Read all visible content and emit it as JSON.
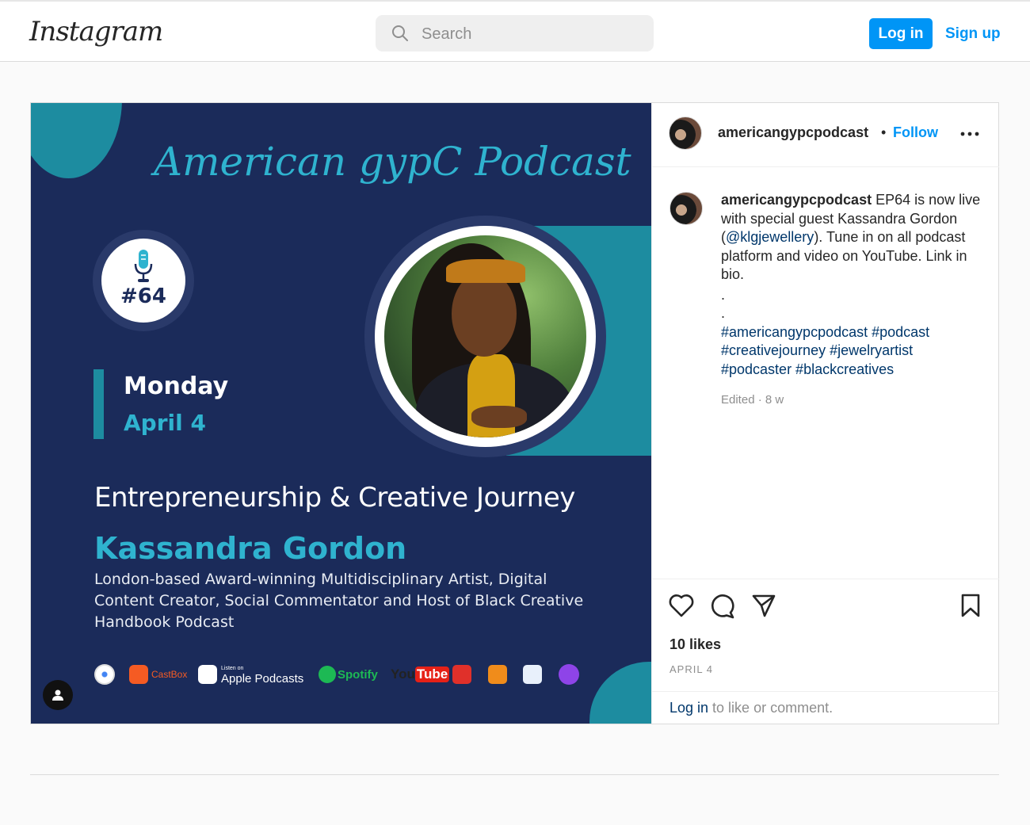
{
  "header": {
    "logo_text": "Instagram",
    "search_placeholder": "Search",
    "login_label": "Log in",
    "signup_label": "Sign up"
  },
  "post_image": {
    "podcast_title": "American gypC Podcast",
    "episode": "#64",
    "day": "Monday",
    "date": "April 4",
    "topic": "Entrepreneurship & Creative Journey",
    "guest_name": "Kassandra Gordon",
    "guest_description": "London-based Award-winning Multidisciplinary Artist, Digital Content Creator, Social Commentator and Host of Black Creative Handbook Podcast",
    "platforms": {
      "castbox": "CastBox",
      "apple_small": "Listen on",
      "apple": "Apple Podcasts",
      "spotify": "Spotify",
      "youtube_you": "You",
      "youtube_tube": "Tube"
    }
  },
  "post": {
    "username": "americangypcpodcast",
    "separator": "•",
    "follow_label": "Follow",
    "caption_username": "americangypcpodcast",
    "caption_text_1": " EP64 is now live with special guest Kassandra Gordon (",
    "caption_mention": "@klgjewellery",
    "caption_text_2": "). Tune in on all podcast platform and video on YouTube. Link in bio.",
    "caption_dot": ".",
    "hashtags_line1": "#americangypcpodcast #podcast",
    "hashtags_line2": "#creativejourney #jewelryartist",
    "hashtags_line3": "#podcaster #blackcreatives",
    "edited": "Edited · 8 w",
    "likes": "10 likes",
    "date": "APRIL 4",
    "login_link": "Log in",
    "login_rest": " to like or comment."
  },
  "colors": {
    "accent": "#0095f6",
    "poster_navy": "#1b2b5a",
    "poster_teal": "#1d8ca0",
    "poster_cyan": "#2fb3cf"
  }
}
